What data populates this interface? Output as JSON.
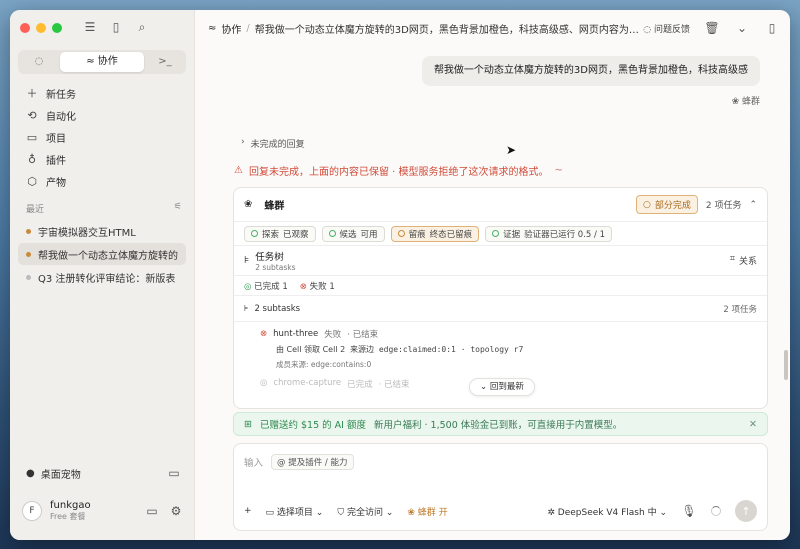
{
  "sidebar": {
    "tabs": [
      {
        "label": "",
        "icon": "chat-icon"
      },
      {
        "label": "协作",
        "icon": "collab-icon"
      },
      {
        "label": "",
        "icon": "terminal-icon"
      }
    ],
    "nav": [
      {
        "label": "新任务",
        "icon": "plus-icon"
      },
      {
        "label": "自动化",
        "icon": "automation-icon"
      },
      {
        "label": "项目",
        "icon": "folder-icon"
      },
      {
        "label": "插件",
        "icon": "plugin-icon"
      },
      {
        "label": "产物",
        "icon": "box-icon"
      }
    ],
    "recent_label": "最近",
    "recent": [
      {
        "label": "宇宙模拟器交互HTML",
        "status": "active"
      },
      {
        "label": "帮我做一个动态立体魔方旋转的",
        "status": "active"
      },
      {
        "label": "Q3 注册转化评审结论：新版表",
        "status": "idle"
      }
    ],
    "pet_label": "桌面宠物",
    "user": {
      "initial": "F",
      "name": "funkgao",
      "plan": "Free 套餐"
    }
  },
  "header": {
    "section": "协作",
    "title": "帮我做一个动态立体魔方旋转的3D网页，黑色背景加橙色，科技高级感、网页内容为「AI...",
    "feedback": "问题反馈"
  },
  "conversation": {
    "user_message": "帮我做一个动态立体魔方旋转的3D网页，黑色背景加橙色，科技高级感",
    "swarm_tag": "蜂群",
    "incomplete_label": "未完成的回复",
    "warning": "回复未完成，上面的内容已保留 · 模型服务拒绝了这次请求的格式。",
    "warning_tail": "~"
  },
  "swarm_card": {
    "name": "蜂群",
    "status": "部分完成",
    "task_count": "2 项任务",
    "pills": [
      {
        "label": "探索",
        "value": "已观察",
        "state": "ok"
      },
      {
        "label": "候选",
        "value": "可用",
        "state": "ok"
      },
      {
        "label": "留痕",
        "value": "终态已留痕",
        "state": "warn"
      },
      {
        "label": "证据",
        "value": "验证器已运行 0.5 / 1",
        "state": "ok"
      }
    ],
    "tree_title": "任务树",
    "tree_sub": "2 subtasks",
    "relation": "关系",
    "done_label": "已完成",
    "done_count": "1",
    "fail_label": "失败",
    "fail_count": "1",
    "subtasks_label": "2 subtasks",
    "subtasks_count": "2 项任务",
    "task": {
      "name": "hunt-three",
      "status": "失败",
      "ended": "· 已结束",
      "line2_a": "由 Cell 领取 Cell 2",
      "line2_b": "来源边 edge:claimed:0:1 · topology r7",
      "line3": "成员来源: edge:contains:0"
    },
    "faded_task": {
      "name": "chrome-capture",
      "status": "已完成",
      "ended": "· 已结束"
    },
    "back_to_bottom": "回到最新"
  },
  "promo": {
    "strong": "已赠送约 $15 的 AI 额度",
    "sub": "新用户福利 · 1,500 体验金已到账，可直接用于内置模型。"
  },
  "composer": {
    "placeholder": "输入",
    "mention": "@ 提及插件 / 能力",
    "add": "+",
    "project": "选择项目",
    "access": "完全访问",
    "swarm": "蜂群",
    "swarm_state": "开",
    "model": "DeepSeek V4 Flash",
    "level": "中"
  },
  "colors": {
    "accent": "#c07a2a",
    "danger": "#d24b3a",
    "success": "#3a9b59"
  }
}
